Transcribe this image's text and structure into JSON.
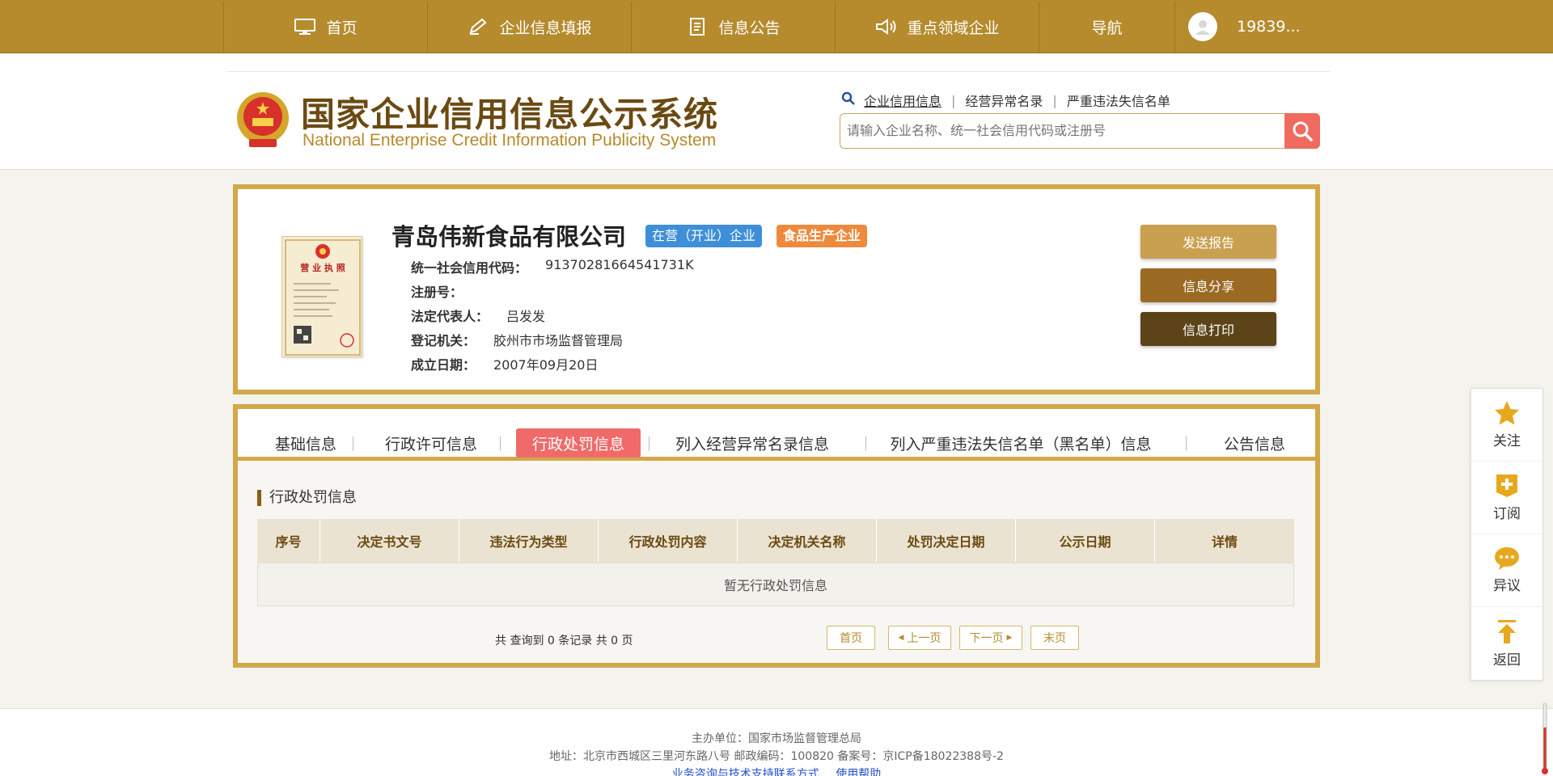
{
  "topnav": {
    "items": [
      {
        "label": "首页",
        "icon": "monitor-icon"
      },
      {
        "label": "企业信息填报",
        "icon": "pen-icon"
      },
      {
        "label": "信息公告",
        "icon": "document-icon"
      },
      {
        "label": "重点领域企业",
        "icon": "speaker-icon"
      },
      {
        "label": "导航",
        "icon": ""
      }
    ],
    "user": "19839..."
  },
  "header": {
    "title_cn": "国家企业信用信息公示系统",
    "title_en": "National Enterprise Credit Information Publicity System",
    "search_links": [
      "企业信用信息",
      "经营异常名录",
      "严重违法失信名单"
    ],
    "search_placeholder": "请输入企业名称、统一社会信用代码或注册号"
  },
  "company": {
    "name": "青岛伟新食品有限公司",
    "status_badge": "在营（开业）企业",
    "type_badge": "食品生产企业",
    "fields": [
      {
        "key": "统一社会信用代码：",
        "value": "91370281664541731K"
      },
      {
        "key": "注册号：",
        "value": ""
      },
      {
        "key": "法定代表人：",
        "value": "吕发发"
      },
      {
        "key": "登记机关：",
        "value": "胶州市市场监督管理局"
      },
      {
        "key": "成立日期：",
        "value": "2007年09月20日"
      }
    ],
    "actions": [
      "发送报告",
      "信息分享",
      "信息打印"
    ],
    "license_title": "营 业 执 照"
  },
  "tabs": {
    "items": [
      "基础信息",
      "行政许可信息",
      "行政处罚信息",
      "列入经营异常名录信息",
      "列入严重违法失信名单（黑名单）信息",
      "公告信息"
    ],
    "active_index": 2
  },
  "penalty": {
    "section_title": "行政处罚信息",
    "columns": [
      "序号",
      "决定书文号",
      "违法行为类型",
      "行政处罚内容",
      "决定机关名称",
      "处罚决定日期",
      "公示日期",
      "详情"
    ],
    "empty_text": "暂无行政处罚信息",
    "pager_info": "共 查询到 0 条记录 共 0 页",
    "pager_buttons": [
      "首页",
      "上一页",
      "下一页",
      "末页"
    ]
  },
  "floatbar": [
    "关注",
    "订阅",
    "异议",
    "返回"
  ],
  "footer": {
    "host": "主办单位：国家市场监督管理总局",
    "address": "地址：北京市西城区三里河东路八号   邮政编码：100820   备案号：京ICP备18022388号-2",
    "help_links": [
      "业务咨询与技术支持联系方式",
      "使用帮助"
    ]
  },
  "colors": {
    "brand_gold": "#b58b2e",
    "frame_gold": "#d2a84a",
    "active_tab": "#f06a6a",
    "status_blue": "#3f8fd8",
    "type_orange": "#ee8a3c",
    "btn_send": "#c9a050",
    "btn_share": "#9a6a22",
    "btn_print": "#5c4418",
    "search_red": "#ef6b5f"
  }
}
